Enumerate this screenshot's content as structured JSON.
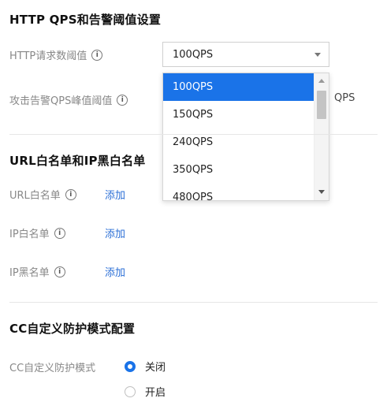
{
  "qps_section": {
    "title": "HTTP QPS和告警阈值设置",
    "http_threshold_label": "HTTP请求数阈值",
    "selected_value": "100QPS",
    "attack_threshold_label": "攻击告警QPS峰值阈值",
    "attack_suffix": "QPS",
    "dropdown_options": [
      "100QPS",
      "150QPS",
      "240QPS",
      "350QPS",
      "480QPS"
    ]
  },
  "list_section": {
    "title": "URL白名单和IP黑白名单",
    "url_whitelist_label": "URL白名单",
    "ip_whitelist_label": "IP白名单",
    "ip_blacklist_label": "IP黑名单",
    "add_link": "添加"
  },
  "cc_section": {
    "title": "CC自定义防护模式配置",
    "mode_label": "CC自定义防护模式",
    "options": [
      {
        "label": "关闭",
        "checked": true
      },
      {
        "label": "开启",
        "checked": false
      }
    ]
  },
  "colors": {
    "accent": "#1a73e8",
    "link": "#2b6fd6"
  },
  "icons": {
    "info": "info-icon",
    "select_caret": "chevron-down-icon"
  }
}
